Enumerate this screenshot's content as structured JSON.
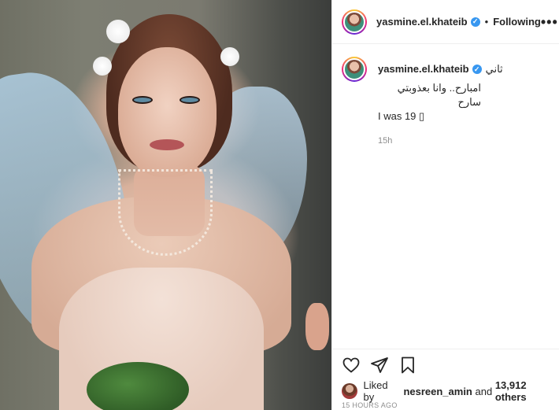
{
  "post": {
    "image_alt": "Bride in white strapless dress with veil and pearl necklace"
  },
  "header": {
    "username": "yasmine.el.khateib",
    "separator": "•",
    "follow_status": "Following",
    "more_icon": "more-horizontal-icon"
  },
  "caption": {
    "username": "yasmine.el.khateib",
    "text_line1": "ثاني",
    "text_line2": "امبارح.. وانا بعذوبتي سارح",
    "text_line3": "I was 19 ▯",
    "time": "15h"
  },
  "actions": {
    "like_icon": "heart-icon",
    "share_icon": "send-icon",
    "save_icon": "bookmark-icon"
  },
  "likes": {
    "prefix": "Liked by",
    "user": "nesreen_amin",
    "middle": "and",
    "others": "13,912 others"
  },
  "timestamp": "15 HOURS AGO",
  "colors": {
    "verified": "#3897f0",
    "text": "#262626",
    "secondary": "#8e8e8e"
  }
}
